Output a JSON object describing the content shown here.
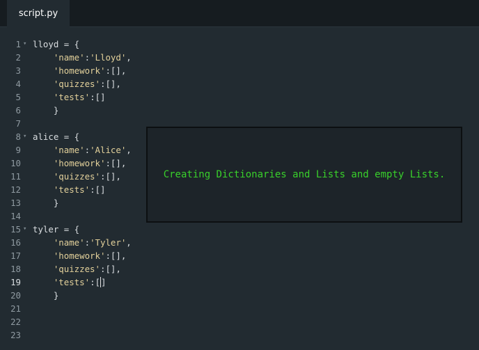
{
  "tab": {
    "label": "script.py"
  },
  "overlay": {
    "text": "Creating Dictionaries and Lists and empty Lists."
  },
  "lines": [
    {
      "n": "1",
      "code": "lloyd = {",
      "fold": true
    },
    {
      "n": "2",
      "code": "    'name':'Lloyd',"
    },
    {
      "n": "3",
      "code": "    'homework':[],"
    },
    {
      "n": "4",
      "code": "    'quizzes':[],"
    },
    {
      "n": "5",
      "code": "    'tests':[]"
    },
    {
      "n": "6",
      "code": "    }"
    },
    {
      "n": "7",
      "code": ""
    },
    {
      "n": "8",
      "code": "alice = {",
      "fold": true
    },
    {
      "n": "9",
      "code": "    'name':'Alice',"
    },
    {
      "n": "10",
      "code": "    'homework':[],"
    },
    {
      "n": "11",
      "code": "    'quizzes':[],"
    },
    {
      "n": "12",
      "code": "    'tests':[]"
    },
    {
      "n": "13",
      "code": "    }"
    },
    {
      "n": "14",
      "code": ""
    },
    {
      "n": "15",
      "code": "tyler = {",
      "fold": true
    },
    {
      "n": "16",
      "code": "    'name':'Tyler',"
    },
    {
      "n": "17",
      "code": "    'homework':[],"
    },
    {
      "n": "18",
      "code": "    'quizzes':[],"
    },
    {
      "n": "19",
      "code": "    'tests':[]",
      "current": true
    },
    {
      "n": "20",
      "code": "    }"
    },
    {
      "n": "21",
      "code": ""
    },
    {
      "n": "22",
      "code": ""
    },
    {
      "n": "23",
      "code": ""
    }
  ],
  "colors": {
    "background": "#222b31",
    "string": "#e3d19b",
    "overlay_text": "#39d02b"
  }
}
